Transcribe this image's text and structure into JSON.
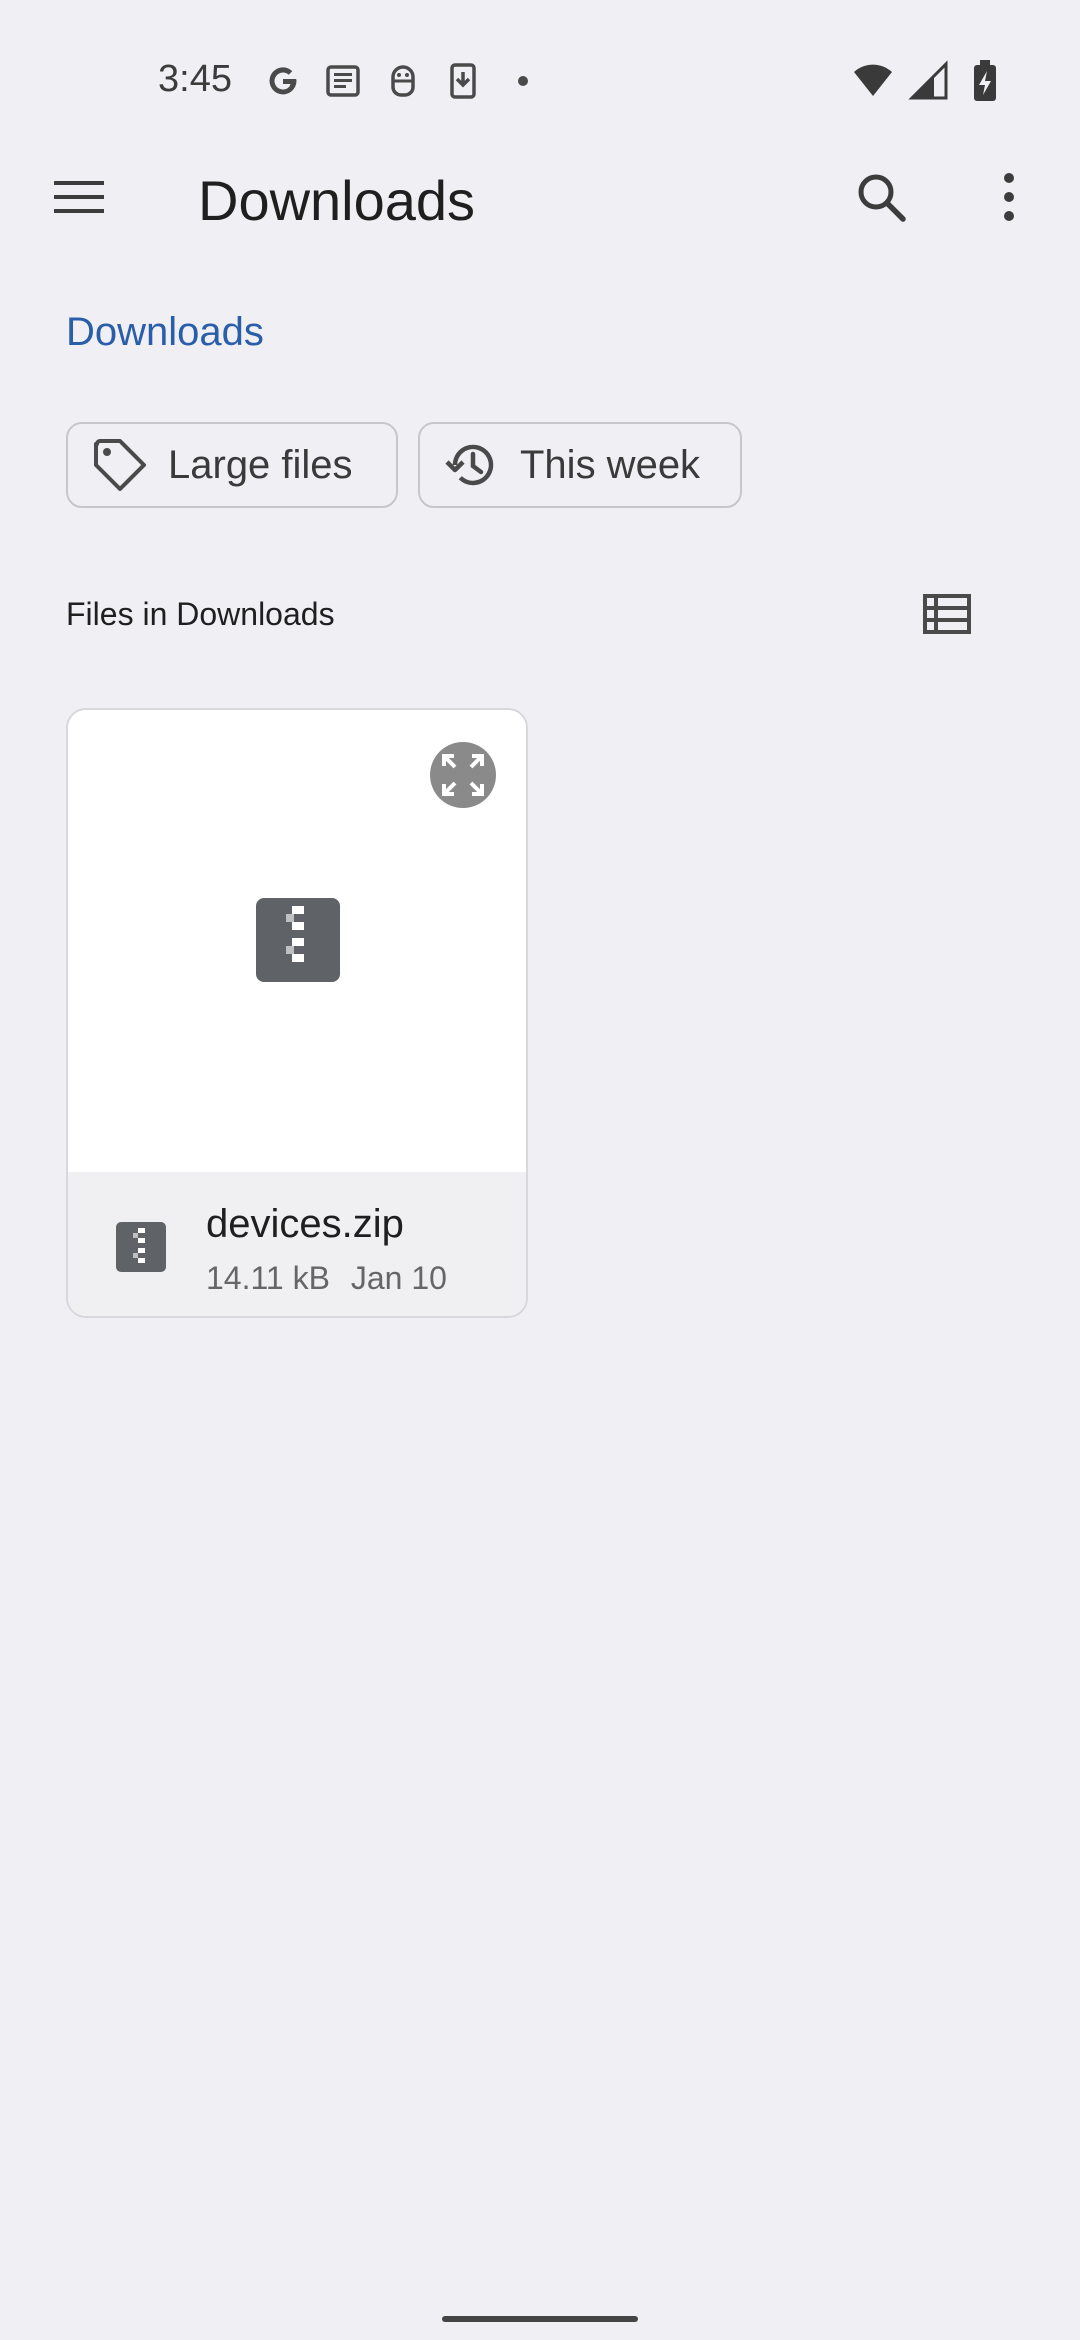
{
  "status_bar": {
    "time": "3:45",
    "left_icons": [
      "google-icon",
      "news-icon",
      "android-icon",
      "download-icon",
      "dot-icon"
    ],
    "right_icons": [
      "wifi-icon",
      "signal-icon",
      "battery-charging-icon"
    ]
  },
  "app_bar": {
    "title": "Downloads",
    "menu_icon": "hamburger-menu-icon",
    "search_icon": "search-icon",
    "more_icon": "more-vert-icon"
  },
  "breadcrumb": {
    "label": "Downloads"
  },
  "filter_chips": [
    {
      "label": "Large files",
      "icon": "tag-icon"
    },
    {
      "label": "This week",
      "icon": "history-icon"
    }
  ],
  "section": {
    "title": "Files in Downloads",
    "view_toggle_icon": "list-view-icon"
  },
  "files": [
    {
      "name": "devices.zip",
      "size": "14.11 kB",
      "date": "Jan 10",
      "type_icon": "zip-file-icon"
    }
  ],
  "colors": {
    "background": "#f0f0f4",
    "breadcrumb": "#2a5ea8",
    "zip_icon": "#5f6368"
  }
}
